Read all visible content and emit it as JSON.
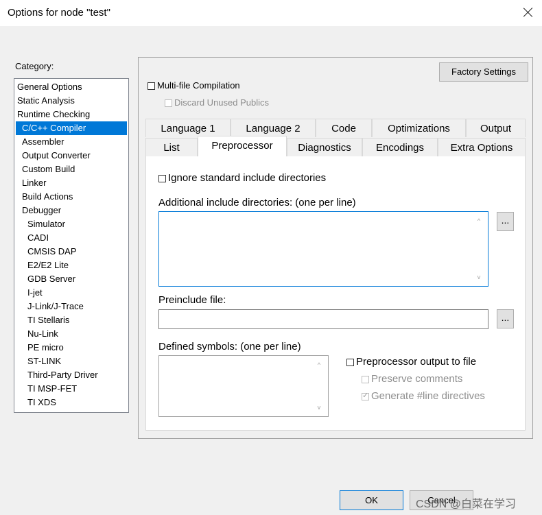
{
  "window": {
    "title": "Options for node \"test\""
  },
  "category": {
    "label": "Category:",
    "items": [
      "General Options",
      "Static Analysis",
      "Runtime Checking",
      "C/C++ Compiler",
      "Assembler",
      "Output Converter",
      "Custom Build",
      "Linker",
      "Build Actions",
      "Debugger",
      "Simulator",
      "CADI",
      "CMSIS DAP",
      "E2/E2 Lite",
      "GDB Server",
      "I-jet",
      "J-Link/J-Trace",
      "TI Stellaris",
      "Nu-Link",
      "PE micro",
      "ST-LINK",
      "Third-Party Driver",
      "TI MSP-FET",
      "TI XDS"
    ],
    "selected": "C/C++ Compiler"
  },
  "top": {
    "factory_settings": "Factory Settings",
    "multi_file": "Multi-file Compilation",
    "discard_unused": "Discard Unused Publics"
  },
  "tabs": {
    "row1": [
      "Language 1",
      "Language 2",
      "Code",
      "Optimizations",
      "Output"
    ],
    "row2": [
      "List",
      "Preprocessor",
      "Diagnostics",
      "Encodings",
      "Extra Options"
    ],
    "active": "Preprocessor"
  },
  "preprocessor": {
    "ignore_std": "Ignore standard include directories",
    "additional_label": "Additional include directories: (one per line)",
    "browse": "...",
    "preinclude_label": "Preinclude file:",
    "defined_label": "Defined symbols: (one per line)",
    "pp_output": "Preprocessor output to file",
    "preserve_comments": "Preserve comments",
    "gen_line": "Generate #line directives",
    "gen_line_checked": true
  },
  "buttons": {
    "ok": "OK",
    "cancel": "Cancel"
  },
  "watermark": "CSDN @白菜在学习",
  "colors": {
    "selection": "#0078d7",
    "window_bg": "#f0f0f0"
  }
}
